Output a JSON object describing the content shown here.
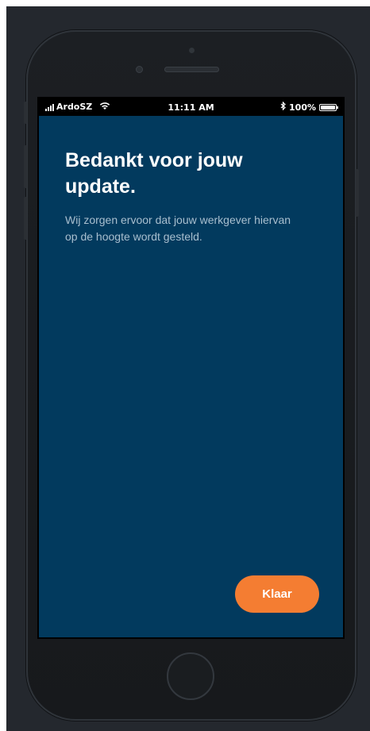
{
  "status_bar": {
    "carrier": "ArdoSZ",
    "time": "11:11 AM",
    "battery_percent": "100%",
    "battery_level": 1.0,
    "icons": [
      "signal-icon",
      "wifi-icon",
      "bluetooth-icon",
      "battery-icon"
    ]
  },
  "content": {
    "title": "Bedankt voor jouw update.",
    "subtitle": "Wij zorgen ervoor dat jouw werkgever hiervan op de hoogte wordt gesteld."
  },
  "actions": {
    "done_label": "Klaar"
  },
  "colors": {
    "screen_background": "#023a5e",
    "accent": "#f47d32",
    "title": "#ffffff",
    "subtitle": "#a9bfcf"
  }
}
